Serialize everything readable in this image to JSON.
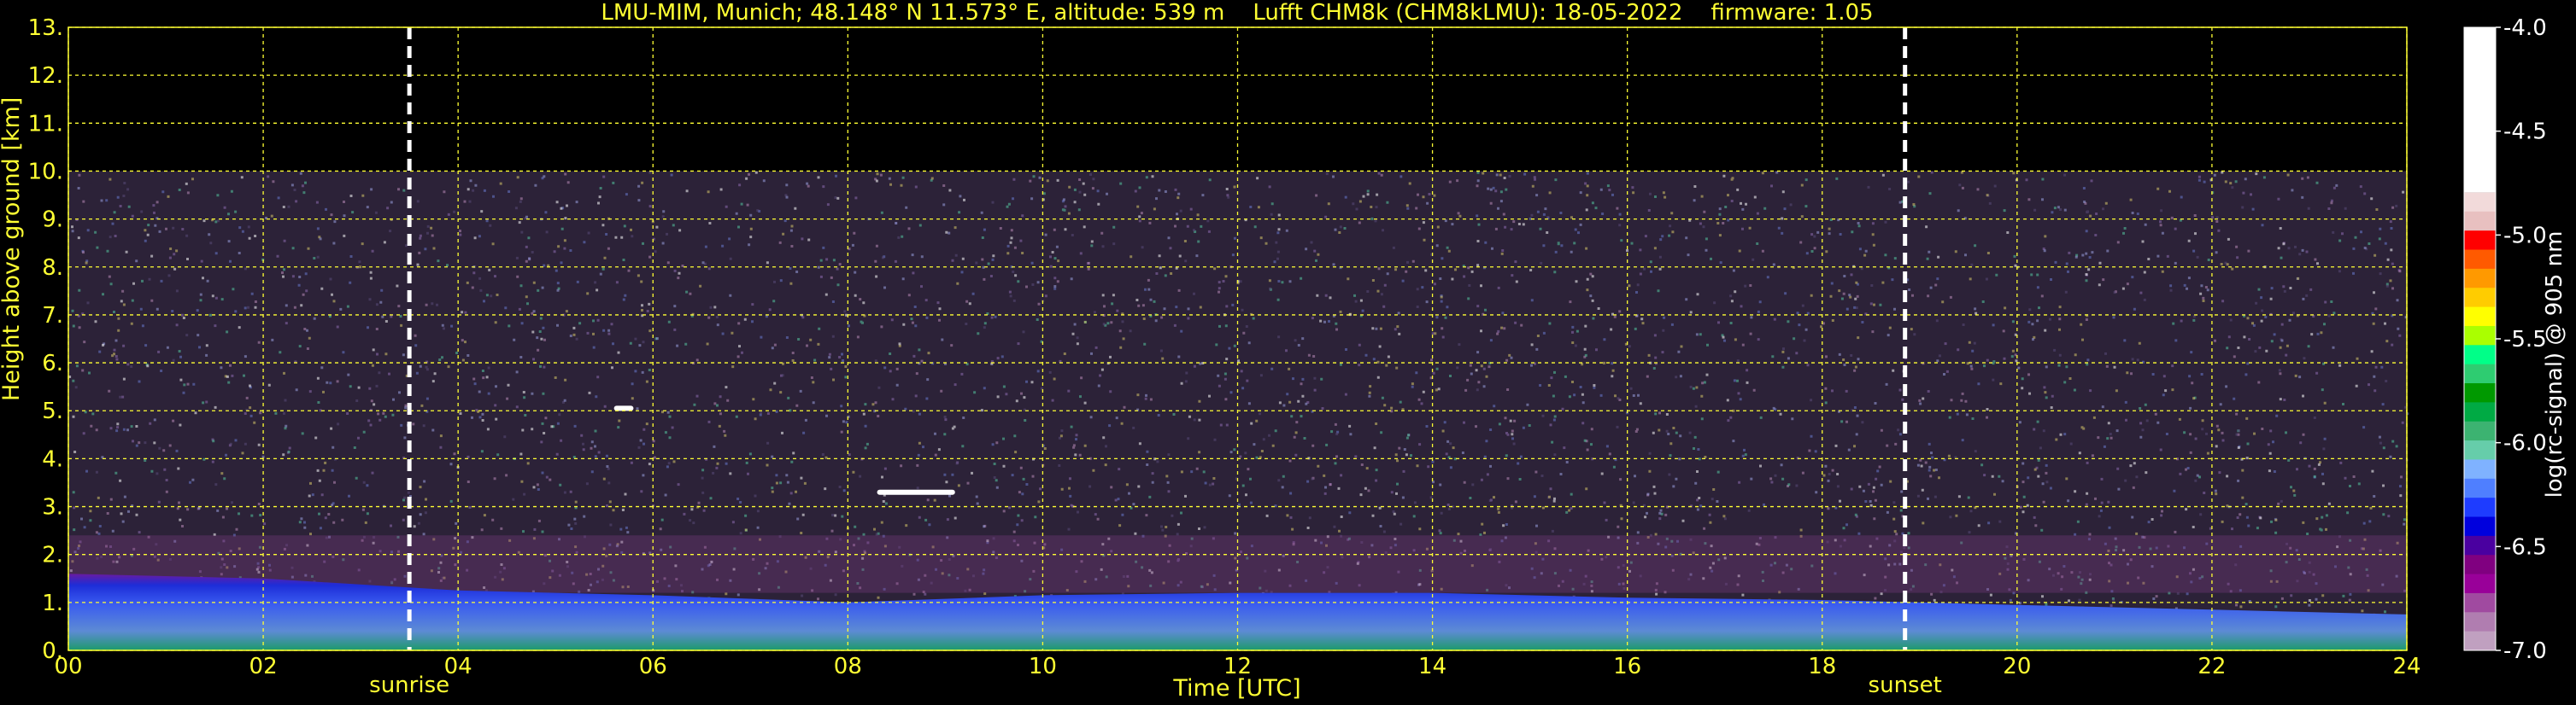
{
  "chart_data": {
    "type": "heatmap",
    "title": "LMU-MIM, Munich; 48.148° N 11.573° E, altitude: 539 m    Lufft CHM8k (CHM8kLMU): 18-05-2022    firmware: 1.05",
    "xlabel": "Time [UTC]",
    "ylabel": "Height above ground [km]",
    "xlim": [
      0,
      24
    ],
    "ylim": [
      0,
      13
    ],
    "x_tick_labels": [
      "00",
      "02",
      "04",
      "06",
      "08",
      "10",
      "12",
      "14",
      "16",
      "18",
      "20",
      "22",
      "24"
    ],
    "y_tick_labels": [
      "0.",
      "1.",
      "2.",
      "3.",
      "4.",
      "5.",
      "6.",
      "7.",
      "8.",
      "9.",
      "10.",
      "11.",
      "12.",
      "13."
    ],
    "grid": true,
    "measured_max_height_km": 10,
    "annotations": [
      {
        "label": "sunrise",
        "x_hours": 3.5
      },
      {
        "label": "sunset",
        "x_hours": 18.85
      }
    ],
    "features": {
      "boundary_layer_top_km": [
        {
          "t": 0,
          "h": 1.6
        },
        {
          "t": 2,
          "h": 1.5
        },
        {
          "t": 4,
          "h": 1.25
        },
        {
          "t": 6,
          "h": 1.15
        },
        {
          "t": 8,
          "h": 1.0
        },
        {
          "t": 10,
          "h": 1.15
        },
        {
          "t": 12,
          "h": 1.2
        },
        {
          "t": 14,
          "h": 1.2
        },
        {
          "t": 16,
          "h": 1.1
        },
        {
          "t": 18,
          "h": 1.05
        },
        {
          "t": 20,
          "h": 0.95
        },
        {
          "t": 22,
          "h": 0.85
        },
        {
          "t": 24,
          "h": 0.75
        }
      ],
      "cloud_layers": [
        {
          "t_start": 8.3,
          "t_end": 9.1,
          "h_km": 3.3
        },
        {
          "t_start": 5.6,
          "t_end": 5.8,
          "h_km": 5.05
        }
      ]
    },
    "colorbar": {
      "label": "log(rc-signal) @ 905 nm",
      "range": [
        -7.0,
        -4.0
      ],
      "tick_labels": [
        "-4.0",
        "-4.5",
        "-5.0",
        "-5.5",
        "-6.0",
        "-6.5",
        "-7.0"
      ],
      "colors_top_to_bottom": [
        "#ffffff",
        "#f2dada",
        "#e8c0c0",
        "#ff0000",
        "#ff5a00",
        "#ff9900",
        "#ffcc00",
        "#ffff00",
        "#aaff00",
        "#00ff88",
        "#2ecc71",
        "#009900",
        "#00aa44",
        "#3cb371",
        "#66cdaa",
        "#7fb2ff",
        "#4f7fff",
        "#1e3cff",
        "#0000dd",
        "#4a00a0",
        "#800080",
        "#990099",
        "#a04aa0",
        "#b07db0",
        "#c0a0c0"
      ]
    }
  }
}
